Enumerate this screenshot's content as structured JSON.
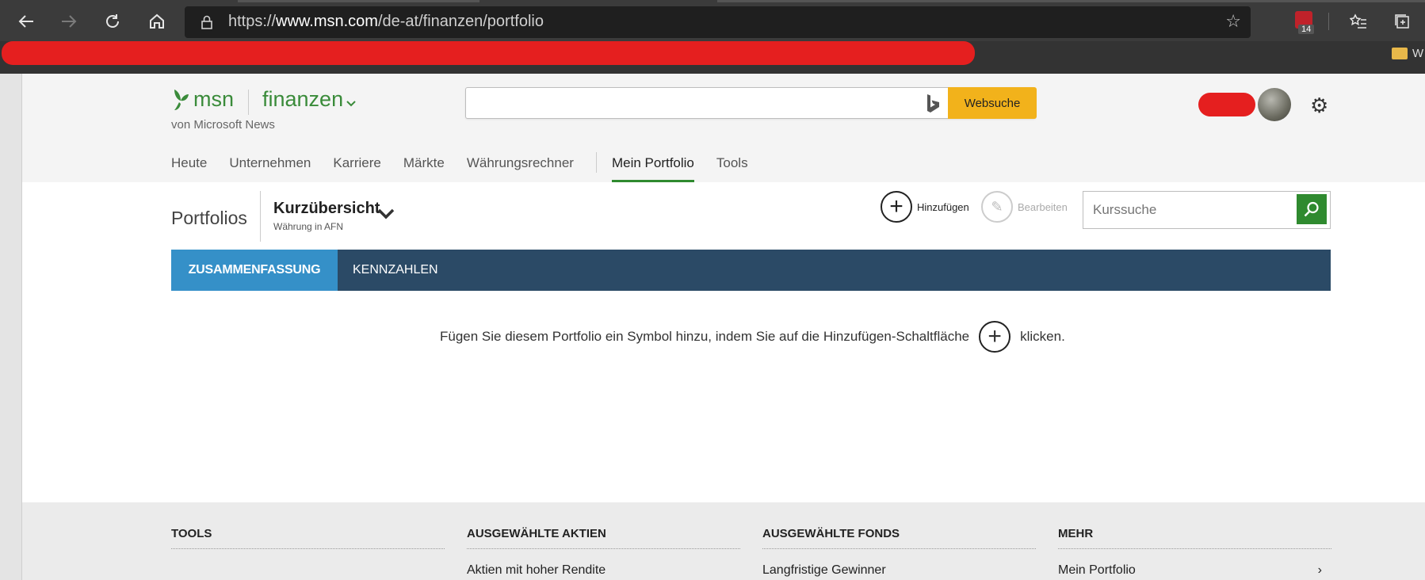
{
  "browser": {
    "url_scheme": "https://",
    "url_host": "www.msn.com",
    "url_path": "/de-at/finanzen/portfolio",
    "extension_badge": "14",
    "bookmark_label": "W"
  },
  "header": {
    "brand": "msn",
    "section": "finanzen",
    "byline": "von Microsoft News",
    "search_placeholder": "",
    "search_button": "Websuche"
  },
  "nav": {
    "items": [
      "Heute",
      "Unternehmen",
      "Karriere",
      "Märkte",
      "Währungsrechner",
      "Mein Portfolio",
      "Tools"
    ],
    "active_index": 5
  },
  "portfolio": {
    "label": "Portfolios",
    "view_title": "Kurzübersicht",
    "view_subtitle": "Währung in AFN",
    "add_label": "Hinzufügen",
    "edit_label": "Bearbeiten",
    "quote_search_placeholder": "Kurssuche"
  },
  "tabs": {
    "summary": "ZUSAMMENFASSUNG",
    "metrics": "KENNZAHLEN"
  },
  "empty_state": {
    "before": "Fügen Sie diesem Portfolio ein Symbol hinzu, indem Sie auf die Hinzufügen-Schaltfläche",
    "after": "klicken."
  },
  "footer": {
    "columns": [
      {
        "heading": "TOOLS",
        "links": []
      },
      {
        "heading": "AUSGEWÄHLTE AKTIEN",
        "links": [
          "Aktien mit hoher Rendite"
        ]
      },
      {
        "heading": "AUSGEWÄHLTE FONDS",
        "links": [
          "Langfristige Gewinner"
        ]
      },
      {
        "heading": "MEHR",
        "links": [
          "Mein Portfolio"
        ]
      }
    ]
  },
  "colors": {
    "brand_green": "#3a8b3a",
    "tab_active": "#3590c8",
    "tab_bar": "#2b4a66",
    "search_button": "#f2b21b"
  }
}
